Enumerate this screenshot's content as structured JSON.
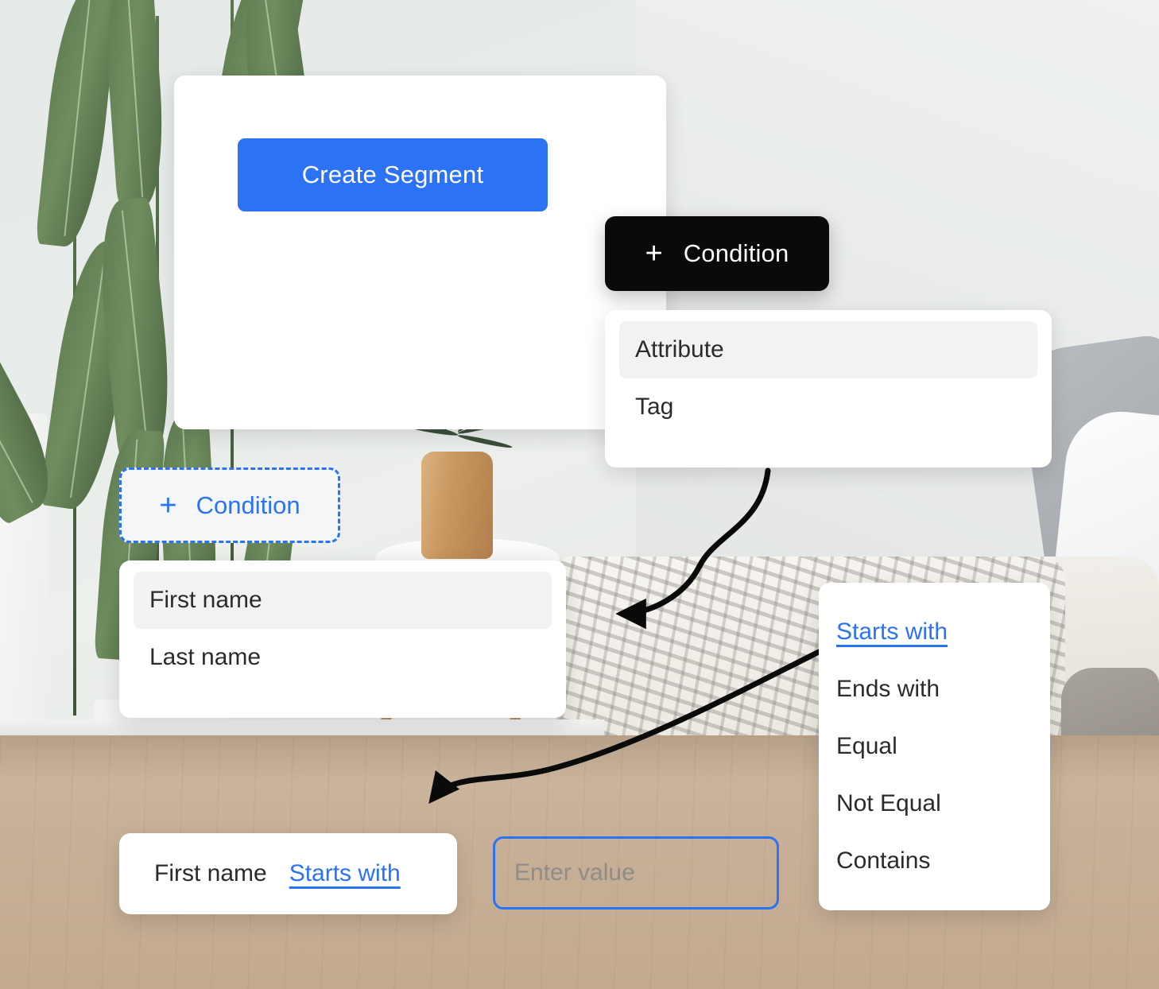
{
  "create_panel": {
    "button_label": "Create Segment"
  },
  "condition_pill": {
    "plus": "+",
    "label": "Condition"
  },
  "attribute_type_menu": {
    "items": [
      {
        "label": "Attribute",
        "selected": true
      },
      {
        "label": "Tag",
        "selected": false
      }
    ]
  },
  "condition_dashed_button": {
    "plus": "+",
    "label": "Condition"
  },
  "attribute_field_menu": {
    "items": [
      {
        "label": "First name",
        "selected": true
      },
      {
        "label": "Last name",
        "selected": false
      }
    ]
  },
  "operator_menu": {
    "items": [
      {
        "label": "Starts with",
        "active": true
      },
      {
        "label": "Ends with",
        "active": false
      },
      {
        "label": "Equal",
        "active": false
      },
      {
        "label": "Not Equal",
        "active": false
      },
      {
        "label": "Contains",
        "active": false
      }
    ]
  },
  "result_card": {
    "field": "First name",
    "operator": "Starts with"
  },
  "value_input": {
    "value": "",
    "placeholder": "Enter value"
  },
  "colors": {
    "accent_blue": "#2b72f5",
    "pill_black": "#0a0a0a",
    "menu_selected_bg": "#f1f2f4",
    "card_white": "#ffffff",
    "text_dark": "#2b2b2e"
  }
}
